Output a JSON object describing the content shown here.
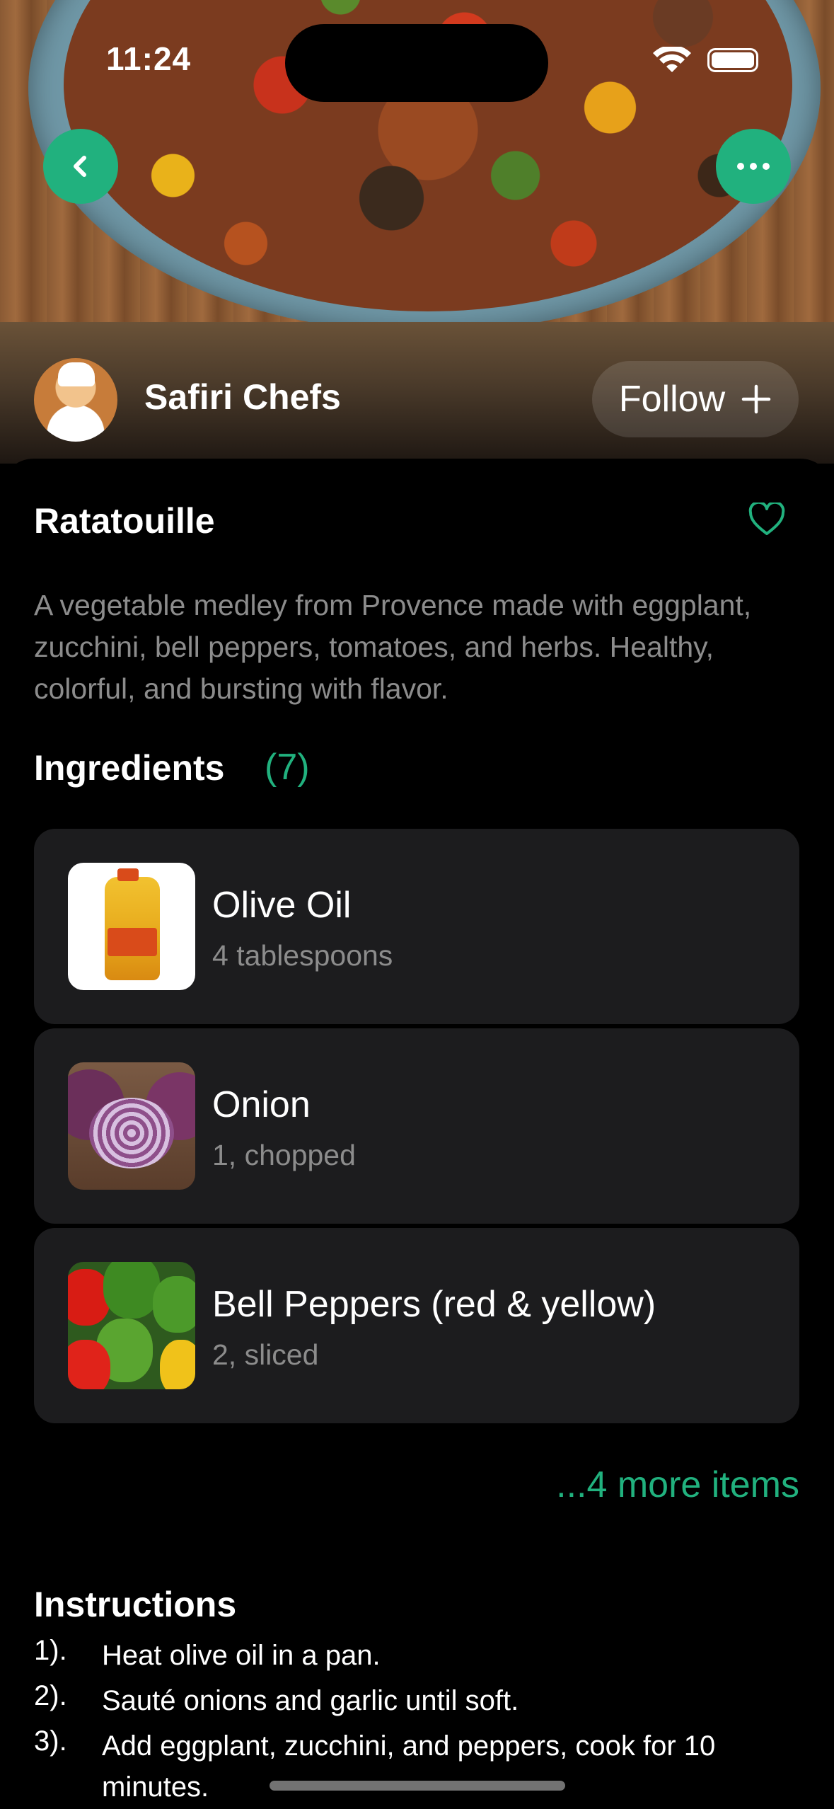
{
  "status_bar": {
    "time": "11:24"
  },
  "chef": {
    "name": "Safiri Chefs",
    "follow_label": "Follow"
  },
  "recipe": {
    "title": "Ratatouille",
    "description": "A vegetable medley from Provence made with eggplant, zucchini, bell peppers, tomatoes, and herbs. Healthy, colorful, and bursting with flavor."
  },
  "ingredients": {
    "heading": "Ingredients",
    "count": "(7)",
    "items": [
      {
        "name": "Olive Oil",
        "quantity": "4 tablespoons",
        "icon": "olive-oil-image"
      },
      {
        "name": "Onion",
        "quantity": "1, chopped",
        "icon": "onion-image"
      },
      {
        "name": "Bell Peppers (red & yellow)",
        "quantity": "2, sliced",
        "icon": "bell-peppers-image"
      }
    ],
    "more_label": "...4 more items"
  },
  "instructions": {
    "heading": "Instructions",
    "steps": [
      {
        "num": "1).",
        "text": "Heat olive oil in a pan."
      },
      {
        "num": "2).",
        "text": "Sauté onions and garlic until soft."
      },
      {
        "num": "3).",
        "text": "Add eggplant, zucchini, and peppers, cook for 10 minutes."
      }
    ]
  },
  "colors": {
    "accent": "#21b17e",
    "card_bg": "#1c1c1e",
    "muted_text": "#8c8c8c"
  }
}
